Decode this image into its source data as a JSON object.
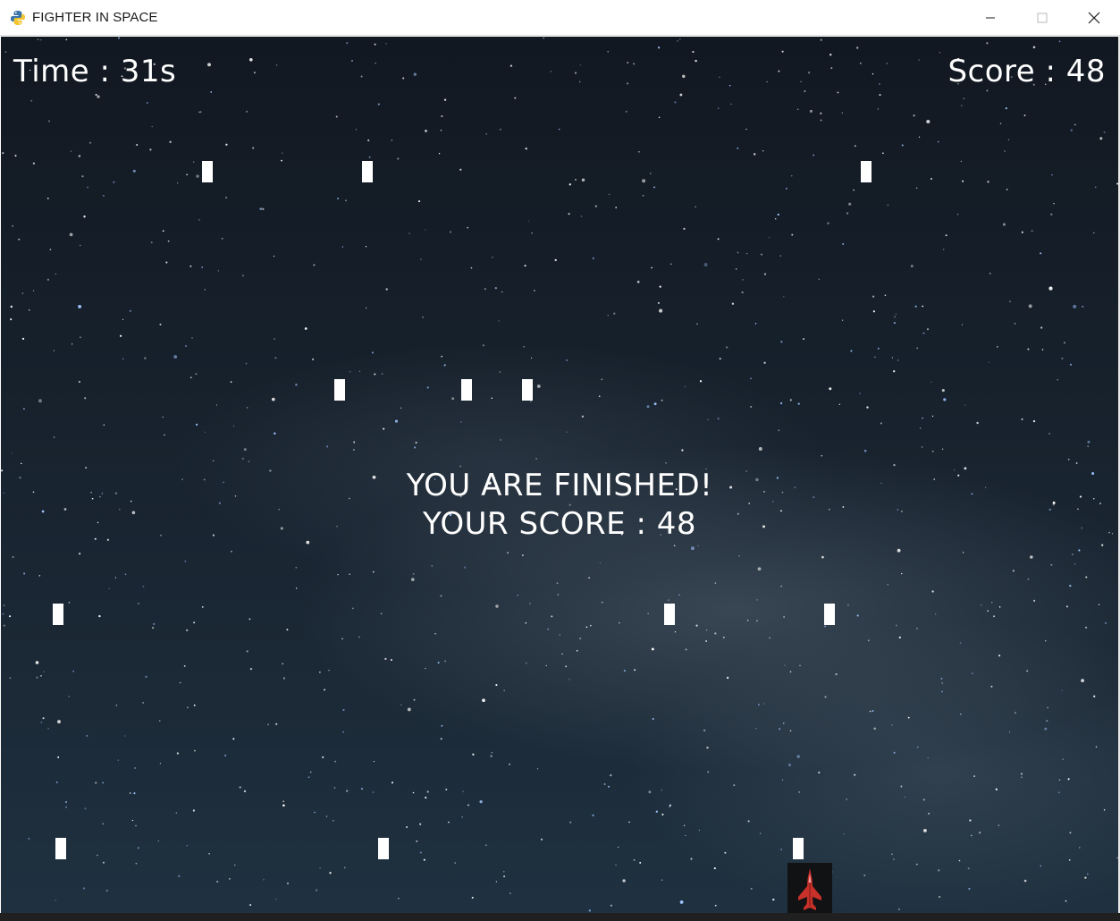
{
  "window": {
    "title": "FIGHTER IN SPACE",
    "app_icon": "python-icon",
    "controls": {
      "minimize_icon": "minimize-icon",
      "maximize_icon": "maximize-icon",
      "close_icon": "close-icon"
    }
  },
  "hud": {
    "time_label": "Time : 31s",
    "score_label": "Score : 48"
  },
  "game_over": {
    "line1": "YOU ARE FINISHED!",
    "line2": "YOUR SCORE : 48"
  },
  "player": {
    "icon": "red-fighter-jet-icon",
    "color": "#d0322b"
  },
  "colors": {
    "bullet": "#ffffff",
    "text": "#ffffff",
    "sky_top": "#121821",
    "sky_bottom": "#1f3140"
  }
}
